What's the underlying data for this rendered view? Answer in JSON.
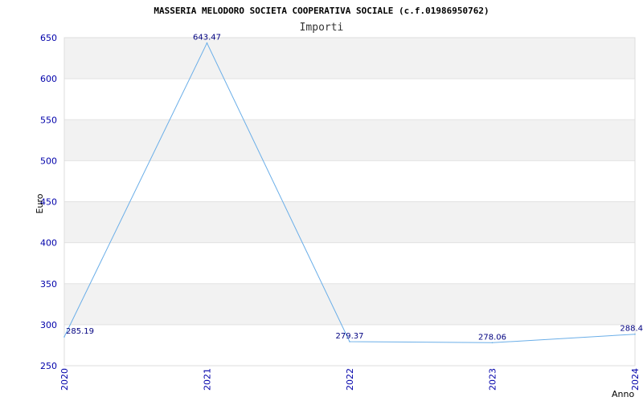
{
  "chart_data": {
    "type": "line",
    "title": "MASSERIA MELODORO SOCIETA COOPERATIVA SOCIALE (c.f.01986950762)",
    "subtitle": "Importi",
    "xlabel": "Anno",
    "ylabel": "Euro",
    "x": [
      "2020",
      "2021",
      "2022",
      "2023",
      "2024"
    ],
    "values": [
      285.19,
      643.47,
      279.37,
      278.06,
      288.4
    ],
    "data_labels": [
      "285.19",
      "643.47",
      "279.37",
      "278.06",
      "288.4"
    ],
    "ylim": [
      250,
      650
    ],
    "yticks": [
      250,
      300,
      350,
      400,
      450,
      500,
      550,
      600,
      650
    ],
    "grid": true,
    "legend": "none",
    "colors": {
      "line": "#6aaee8",
      "band": "#f2f2f2",
      "tick_text": "#0000aa",
      "label_text": "#000080"
    }
  }
}
